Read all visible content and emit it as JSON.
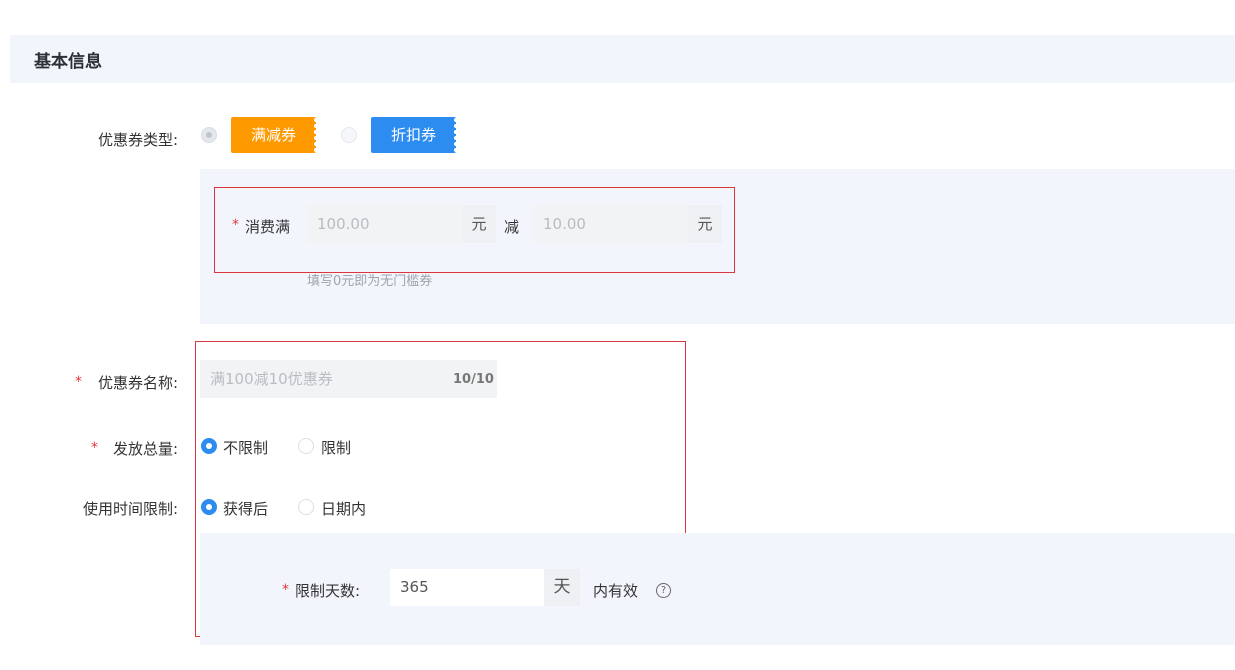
{
  "section": {
    "title": "基本信息"
  },
  "coupon_type": {
    "label": "优惠券类型:",
    "options": [
      {
        "label": "满减券",
        "color": "#ff9900"
      },
      {
        "label": "折扣券",
        "color": "#2d8cf0"
      }
    ]
  },
  "spend": {
    "label": "消费满",
    "threshold_placeholder": "100.00",
    "threshold_unit": "元",
    "minus_label": "减",
    "discount_placeholder": "10.00",
    "discount_unit": "元",
    "hint": "填写0元即为无门槛券"
  },
  "coupon_name": {
    "label": "优惠券名称:",
    "placeholder": "满100减10优惠券",
    "counter": "10/10"
  },
  "total_amount": {
    "label": "发放总量:",
    "options": [
      "不限制",
      "限制"
    ]
  },
  "usage_time": {
    "label": "使用时间限制:",
    "options": [
      "获得后",
      "日期内"
    ]
  },
  "limit_days": {
    "label": "限制天数:",
    "value": "365",
    "unit": "天",
    "suffix": "内有效",
    "help_icon": "?"
  },
  "colors": {
    "required": "#e4393c",
    "accent": "#2d8cf0",
    "highlight_border": "#d9363e"
  }
}
